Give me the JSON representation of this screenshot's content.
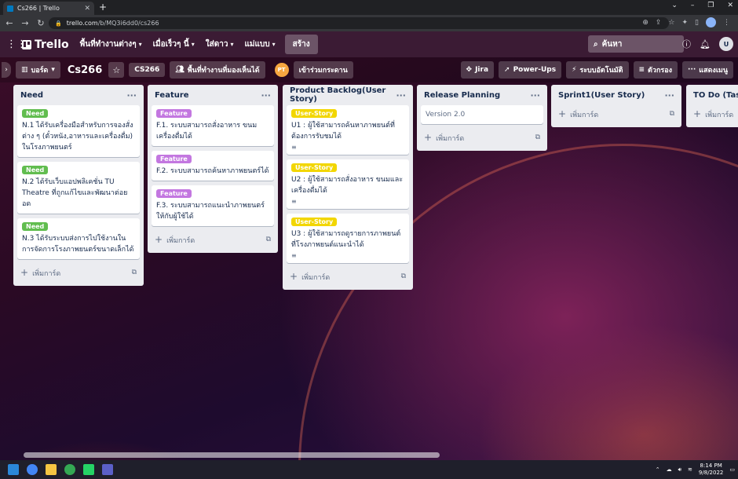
{
  "browser": {
    "tab_title": "Cs266 | Trello",
    "url_host": "trello.com",
    "url_path": "/b/MQ3i6dd0/cs266"
  },
  "header": {
    "logo": "Trello",
    "menus": [
      "พื้นที่ทำงานต่างๆ",
      "เมื่อเร็วๆ นี้",
      "ใส่ดาว",
      "แม่แบบ"
    ],
    "create_label": "สร้าง",
    "search_placeholder": "ค้นหา",
    "user_initial": "U"
  },
  "board": {
    "view_label": "บอร์ด",
    "title": "Cs266",
    "workspace": "CS266",
    "visibility": "พื้นที่ทำงานที่มองเห็นได้",
    "member_initials": "PT",
    "join_label": "เข้าร่วมกระดาน",
    "jira": "Jira",
    "powerups": "Power-Ups",
    "automation": "ระบบอัตโนมัติ",
    "filter": "ตัวกรอง",
    "show_menu": "แสดงเมนู"
  },
  "add_card_label": "เพิ่มการ์ด",
  "colors": {
    "need": "#61bd4f",
    "feature": "#c377e0",
    "user_story": "#f2d600"
  },
  "lists": [
    {
      "title": "Need",
      "cards": [
        {
          "label": "Need",
          "label_color": "#61bd4f",
          "text": "N.1 ได้รับเครื่องมือสำหรับการจองสั่งต่าง ๆ (ตั๋วหนัง,อาหารและเครื่องดื่ม) ในโรงภาพยนตร์"
        },
        {
          "label": "Need",
          "label_color": "#61bd4f",
          "text": "N.2 ได้รับเว็บแอปพลิเคชั่น TU Theatre ที่ถูกแก้ไขและพัฒนาต่อยอด"
        },
        {
          "label": "Need",
          "label_color": "#61bd4f",
          "text": "N.3 ได้รับระบบส่งการไปใช้งานในการจัดการโรงภาพยนตร์ขนาดเล็กได้"
        }
      ]
    },
    {
      "title": "Feature",
      "cards": [
        {
          "label": "Feature",
          "label_color": "#c377e0",
          "text": "F.1. ระบบสามารถสั่งอาหาร ขนม เครื่องดื่มได้"
        },
        {
          "label": "Feature",
          "label_color": "#c377e0",
          "text": "F.2. ระบบสามารถค้นหาภาพยนตร์ได้"
        },
        {
          "label": "Feature",
          "label_color": "#c377e0",
          "text": "F.3. ระบบสามารถแนะนำภาพยนตร์ให้กับผู้ใช้ได้"
        }
      ]
    },
    {
      "title": "Product Backlog(User Story)",
      "cards": [
        {
          "label": "User-Story",
          "label_color": "#f2d600",
          "text": "U1 : ผู้ใช้สามารถค้นหาภาพยนต์ที่ต้องการรับชมได้",
          "desc": "≡"
        },
        {
          "label": "User-Story",
          "label_color": "#f2d600",
          "text": "U2 : ผู้ใช้สามารถสั่งอาหาร ขนมและเครื่องดื่มได้",
          "desc": "≡"
        },
        {
          "label": "User-Story",
          "label_color": "#f2d600",
          "text": "U3 : ผู้ใช้สามารถดูรายการภาพยนต์ที่โรงภาพยนต์แนะนำได้",
          "desc": "≡"
        }
      ]
    },
    {
      "title": "Release Planning",
      "cards": [
        {
          "text": "Version 2.0"
        }
      ]
    },
    {
      "title": "Sprint1(User Story)",
      "cards": []
    },
    {
      "title": "TO Do (Task)",
      "cards": []
    }
  ],
  "taskbar": {
    "time": "8:14 PM",
    "date": "9/8/2022"
  }
}
